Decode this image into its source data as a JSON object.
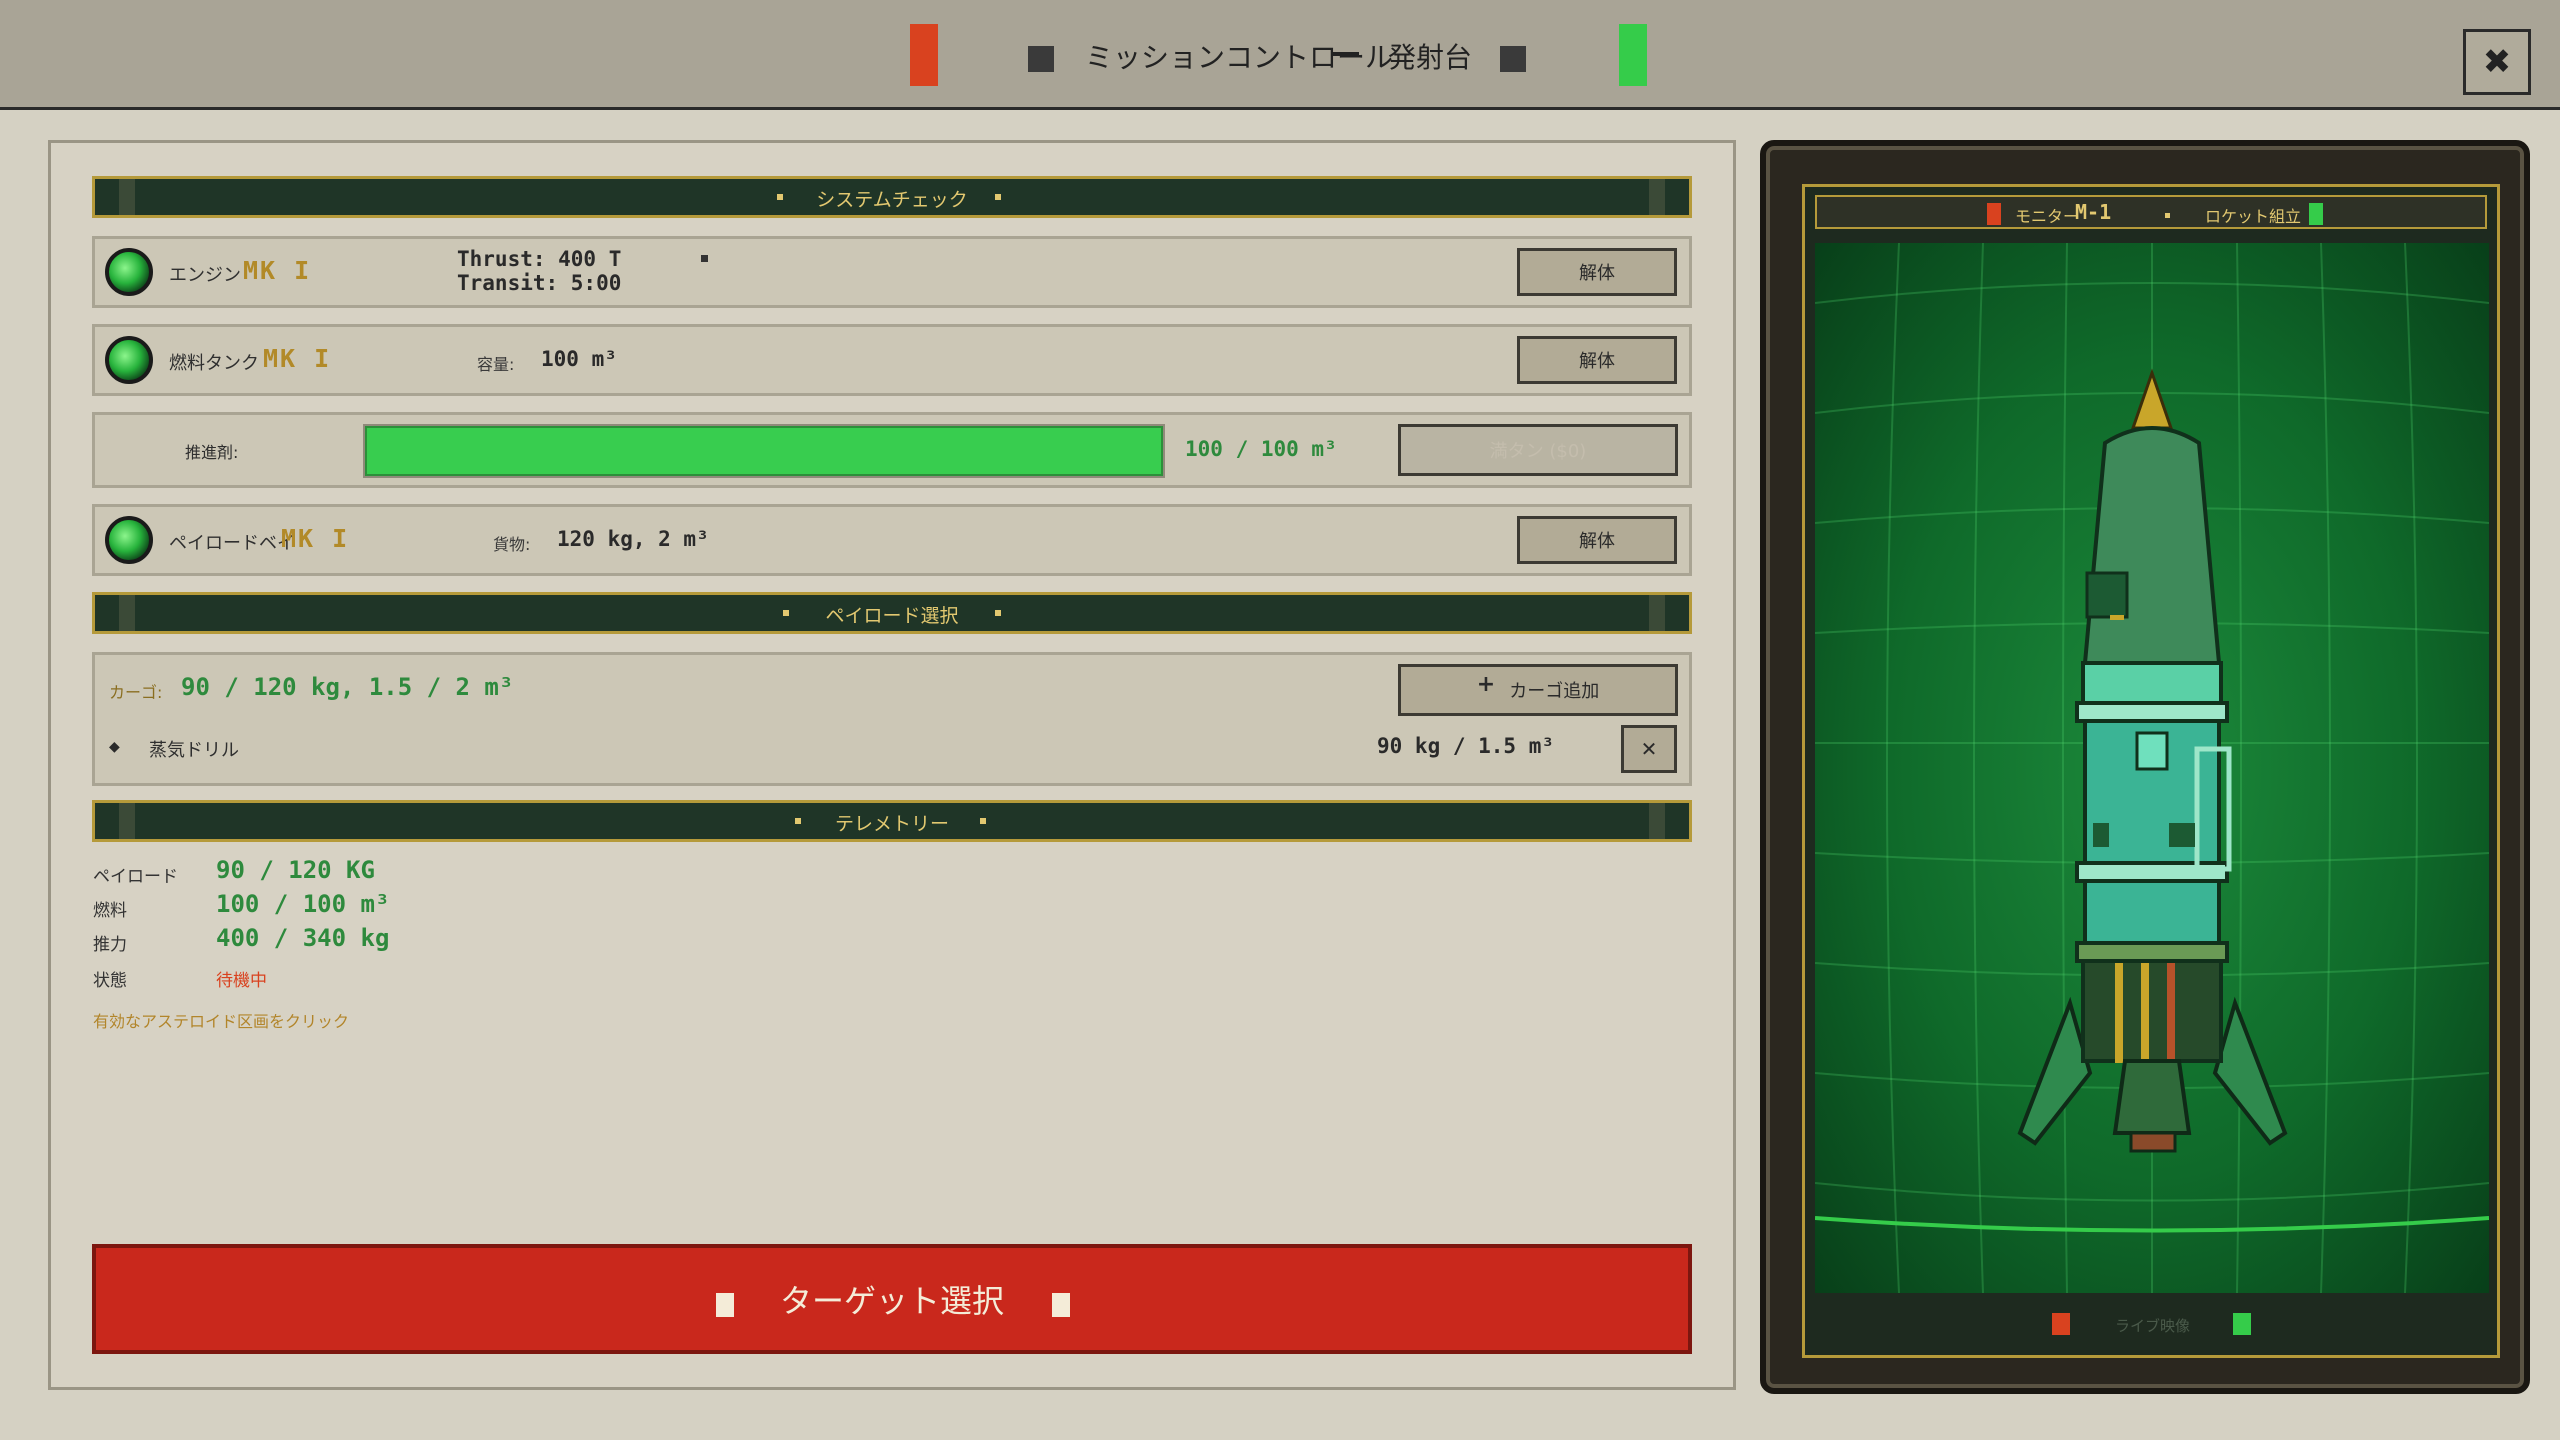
{
  "header": {
    "title": "ミッションコントロール",
    "subtitle": "発射台",
    "close_label": "✖"
  },
  "system_check": {
    "title": "システムチェック",
    "engine": {
      "label": "エンジン",
      "mk": "MK I",
      "thrust": "Thrust: 400 T",
      "transit": "Transit: 5:00",
      "button": "解体"
    },
    "fuel_tank": {
      "label": "燃料タンク",
      "mk": "MK I",
      "capacity_label": "容量:",
      "capacity_value": "100 m³",
      "button": "解体"
    },
    "propellant": {
      "label": "推進剤:",
      "value": "100 / 100 m³",
      "fill_fraction": 1.0,
      "button": "満タン ($0)"
    },
    "payload_bay": {
      "label": "ペイロードベイ",
      "mk": "MK I",
      "cargo_label": "貨物:",
      "cargo_value": "120 kg, 2 m³",
      "button": "解体"
    }
  },
  "payload_select": {
    "title": "ペイロード選択",
    "cargo_label": "カーゴ:",
    "cargo_value": "90 / 120 kg, 1.5 / 2 m³",
    "add_button": "カーゴ追加",
    "add_icon": "+",
    "items": [
      {
        "bullet": "◆",
        "name": "蒸気ドリル",
        "stats": "90 kg / 1.5 m³",
        "remove": "✕"
      }
    ]
  },
  "telemetry": {
    "title": "テレメトリー",
    "rows": [
      {
        "label": "ペイロード",
        "value": "90 / 120 KG"
      },
      {
        "label": "燃料",
        "value": "100 / 100 m³"
      },
      {
        "label": "推力",
        "value": "400 / 340 kg"
      }
    ],
    "status_label": "状態",
    "status_value": "待機中",
    "hint": "有効なアステロイド区画をクリック"
  },
  "launch_button": "ターゲット選択",
  "monitor": {
    "label_left": "モニター",
    "label_id": "M-1",
    "label_right": "ロケット組立",
    "footer": "ライブ映像"
  },
  "colors": {
    "accent_red": "#c9281c",
    "accent_green": "#35cc4a",
    "gold": "#b28a28",
    "status_red": "#d9421f"
  }
}
